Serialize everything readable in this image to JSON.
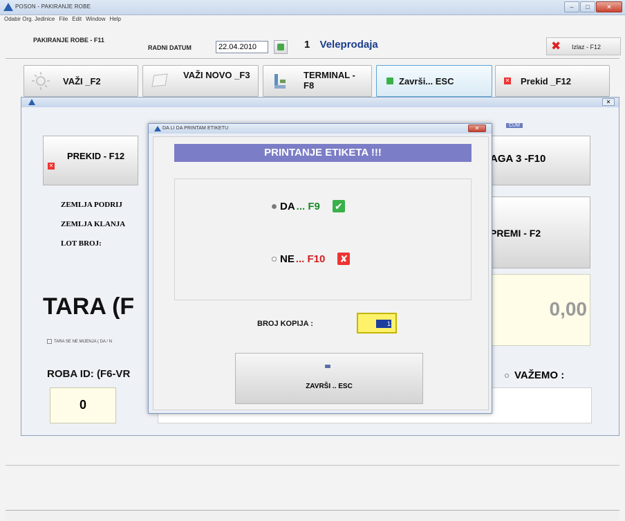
{
  "window": {
    "title": "POSON - PAKIRANJE ROBE"
  },
  "menu": [
    "Odabir Org. Jedinice",
    "File",
    "Edit",
    "Window",
    "Help"
  ],
  "toolbar": {
    "module_label": "PAKIRANJE ROBE - F11",
    "radni_datum_label": "RADNI DATUM",
    "radni_datum_value": "22.04.2010",
    "org_number": "1",
    "org_name": "Veleprodaja",
    "exit_label": "Izlaz - F12"
  },
  "actions": [
    {
      "label": "VAŽI _F2",
      "icon": "sun-icon"
    },
    {
      "label": "VAŽI NOVO _F3",
      "icon": "paper-icon"
    },
    {
      "label": "TERMINAL -F8",
      "icon": "terminal-icon"
    },
    {
      "label": "Završi... ESC",
      "icon": "check-icon"
    },
    {
      "label": "Prekid _F12",
      "icon": "close-icon"
    }
  ],
  "inner": {
    "prekid_label": "PREKID - F12",
    "vaga_label": "AGA 3  -F10",
    "cum_label": "CUM",
    "zemlja_podrijetla": "ZEMLJA PODRIJ",
    "zemlja_klanja": "ZEMLJA KLANJA",
    "lot_broj": "LOT BROJ:",
    "tara_label": "TARA (F",
    "tara_note": "TARA SE NE MIJENJA ( DA / N",
    "primi_label": "PREMI - F2",
    "tara_value": "0,00",
    "roba_label": "ROBA ID: (F6-VR",
    "roba_value": "0",
    "vazemo_label": "VAŽEMO :"
  },
  "dialog": {
    "title": "DA LI DA PRINTAM ETIKETU",
    "heading": "PRINTANJE ETIKETA !!!",
    "option_yes": "DA",
    "option_yes_key": "... F9",
    "option_no": "NE",
    "option_no_key": "... F10",
    "broj_kopija_label": "BROJ KOPIJA :",
    "broj_kopija_value": "1",
    "zavrsi_label": "ZAVRŠI .. ESC",
    "selected_option": "DA"
  },
  "colors": {
    "banner": "#7b7dc6",
    "veleprodaja": "#1a3c8a",
    "key_green": "#1a8a2a",
    "key_red": "#d21f1f",
    "kopija_bg": "#fdf26a"
  }
}
